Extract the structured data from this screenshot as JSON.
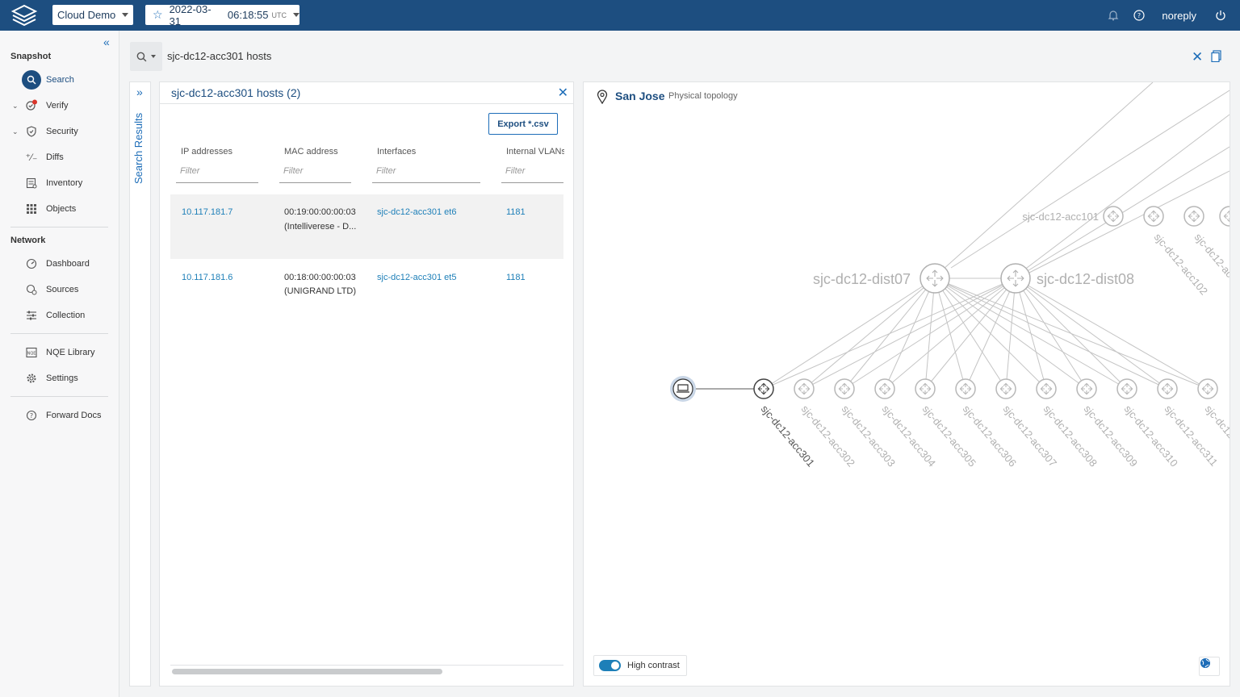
{
  "topbar": {
    "workspace": "Cloud Demo",
    "snapshot_date": "2022-03-31",
    "snapshot_time": "06:18:55",
    "snapshot_tz": "UTC",
    "user": "noreply"
  },
  "sidebar": {
    "snapshot_heading": "Snapshot",
    "network_heading": "Network",
    "items": {
      "search": "Search",
      "verify": "Verify",
      "security": "Security",
      "diffs": "Diffs",
      "inventory": "Inventory",
      "objects": "Objects",
      "dashboard": "Dashboard",
      "sources": "Sources",
      "collection": "Collection",
      "nqe_library": "NQE Library",
      "settings": "Settings",
      "forward_docs": "Forward Docs"
    }
  },
  "search": {
    "query": "sjc-dc12-acc301 hosts"
  },
  "rail": {
    "title": "Search Results"
  },
  "results": {
    "title": "sjc-dc12-acc301 hosts (2)",
    "export_label": "Export *.csv",
    "columns": [
      "IP addresses",
      "MAC address",
      "Interfaces",
      "Internal VLANs"
    ],
    "filter_placeholder": "Filter",
    "rows": [
      {
        "ip": "10.117.181.7",
        "mac": "00:19:00:00:00:03",
        "vendor": "(Intelliverese - D...",
        "iface": "sjc-dc12-acc301 et6",
        "vlan": "1181"
      },
      {
        "ip": "10.117.181.6",
        "mac": "00:18:00:00:00:03",
        "vendor": "(UNIGRAND LTD)",
        "iface": "sjc-dc12-acc301 et5",
        "vlan": "1181"
      }
    ]
  },
  "topology": {
    "location": "San Jose",
    "subtitle": "Physical topology",
    "high_contrast_label": "High contrast",
    "dist_nodes": [
      "sjc-dc12-dist07",
      "sjc-dc12-dist08"
    ],
    "top_nodes": [
      "sjc-dc12-acc101",
      "sjc-dc12-acc102",
      "sjc-dc12-acc"
    ],
    "acc_nodes": [
      "sjc-dc12-acc301",
      "sjc-dc12-acc302",
      "sjc-dc12-acc303",
      "sjc-dc12-acc304",
      "sjc-dc12-acc305",
      "sjc-dc12-acc306",
      "sjc-dc12-acc307",
      "sjc-dc12-acc308",
      "sjc-dc12-acc309",
      "sjc-dc12-acc310",
      "sjc-dc12-acc311",
      "sjc-dc12-"
    ]
  }
}
